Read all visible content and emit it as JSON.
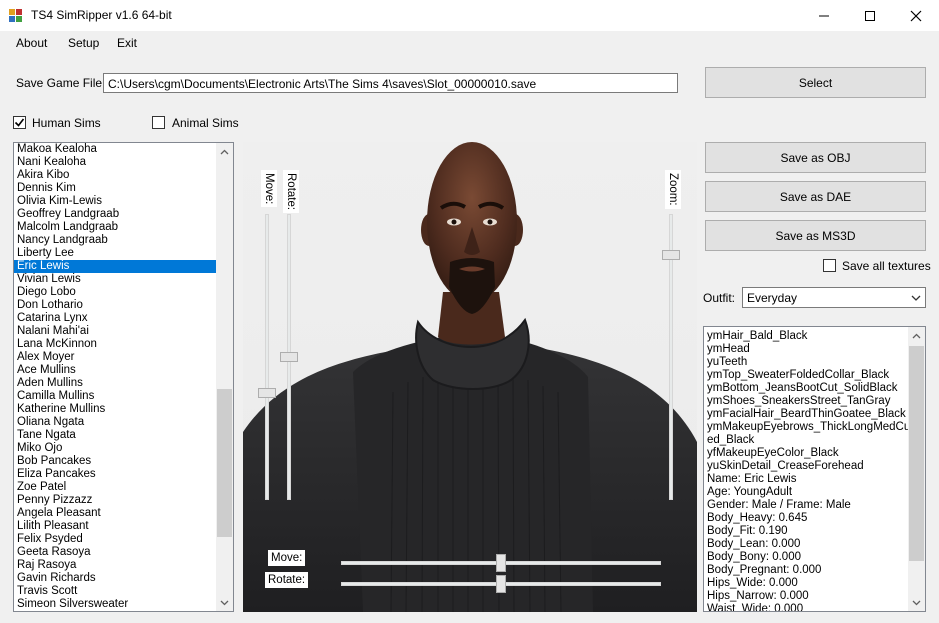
{
  "window": {
    "title": "TS4 SimRipper v1.6 64-bit"
  },
  "menu": {
    "about": "About",
    "setup": "Setup",
    "exit": "Exit"
  },
  "save_file": {
    "label": "Save Game File:",
    "value": "C:\\Users\\cgm\\Documents\\Electronic Arts\\The Sims 4\\saves\\Slot_00000010.save",
    "select_button": "Select"
  },
  "filters": {
    "human_label": "Human Sims",
    "human_checked": true,
    "animal_label": "Animal Sims",
    "animal_checked": false
  },
  "sims": [
    "Makoa Kealoha",
    "Nani Kealoha",
    "Akira Kibo",
    "Dennis Kim",
    "Olivia Kim-Lewis",
    "Geoffrey Landgraab",
    "Malcolm Landgraab",
    "Nancy Landgraab",
    "Liberty Lee",
    "Eric Lewis",
    "Vivian Lewis",
    "Diego Lobo",
    "Don Lothario",
    "Catarina Lynx",
    "Nalani Mahi'ai",
    "Lana McKinnon",
    "Alex Moyer",
    "Ace Mullins",
    "Aden Mullins",
    "Camilla Mullins",
    "Katherine Mullins",
    "Oliana Ngata",
    "Tane Ngata",
    "Miko Ojo",
    "Bob Pancakes",
    "Eliza Pancakes",
    "Zoe Patel",
    "Penny Pizzazz",
    "Angela Pleasant",
    "Lilith Pleasant",
    "Felix Psyded",
    "Geeta Rasoya",
    "Raj Rasoya",
    "Gavin Richards",
    "Travis Scott",
    "Simeon Silversweater"
  ],
  "selected_sim": "Eric Lewis",
  "sliders": {
    "move_label": "Move:",
    "rotate_label": "Rotate:",
    "zoom_label": "Zoom:",
    "h_move_label": "Move:",
    "h_rotate_label": "Rotate:",
    "v_move_level": 0.63,
    "v_rotate_level": 0.5,
    "zoom_level": 0.13,
    "h_move_level": 0.5,
    "h_rotate_level": 0.5
  },
  "actions": {
    "save_obj": "Save as OBJ",
    "save_dae": "Save as DAE",
    "save_ms3d": "Save as MS3D",
    "save_textures_label": "Save all textures",
    "save_textures_checked": false
  },
  "outfit": {
    "label": "Outfit:",
    "value": "Everyday"
  },
  "info_lines": [
    "ymHair_Bald_Black",
    "ymHead",
    "yuTeeth",
    "ymTop_SweaterFoldedCollar_Black",
    "ymBottom_JeansBootCut_SolidBlack",
    "ymShoes_SneakersStreet_TanGray",
    "ymFacialHair_BeardThinGoatee_Black",
    "ymMakeupEyebrows_ThickLongMedCurv",
    "ed_Black",
    "yfMakeupEyeColor_Black",
    "yuSkinDetail_CreaseForehead",
    "Name: Eric Lewis",
    "Age: YoungAdult",
    "Gender: Male / Frame: Male",
    "Body_Heavy: 0.645",
    "Body_Fit: 0.190",
    "Body_Lean: 0.000",
    "Body_Bony: 0.000",
    "Body_Pregnant: 0.000",
    "Hips_Wide: 0.000",
    "Hips_Narrow: 0.000",
    "Waist_Wide: 0.000"
  ],
  "colors": {
    "selection": "#0078d7",
    "skin": "#5a3426",
    "sweater": "#2a2a2c"
  }
}
